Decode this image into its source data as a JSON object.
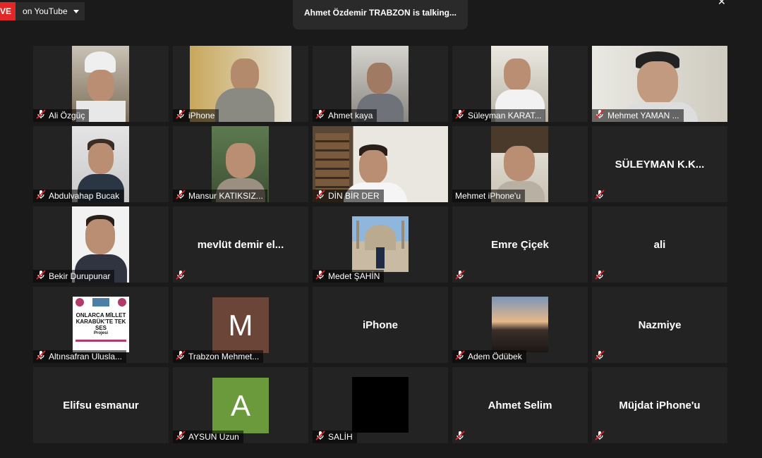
{
  "live": {
    "badge": "VE",
    "platform": "on YouTube"
  },
  "talking": "Ahmet Özdemir TRABZON is talking...",
  "tiles": [
    {
      "name": "Ali Özgüç"
    },
    {
      "name": "iPhone"
    },
    {
      "name": "Ahmet kaya"
    },
    {
      "name": "Süleyman KARAT..."
    },
    {
      "name": "Mehmet YAMAN ..."
    },
    {
      "name": "Abdulvahap Bucak"
    },
    {
      "name": "Mansur KATIKSIZ..."
    },
    {
      "name": "DİN BİR DER"
    },
    {
      "name": "Mehmet iPhone'u"
    },
    {
      "name": "SÜLEYMAN  K.K..."
    },
    {
      "name": "Bekir Durupunar"
    },
    {
      "name": "mevlüt  demir  el..."
    },
    {
      "name": "Medet ŞAHİN"
    },
    {
      "name": "Emre Çiçek"
    },
    {
      "name": "ali"
    },
    {
      "name": "Altınsafran Uluslа...",
      "thumb_lines": [
        "ONLARCA MİLLET",
        "KARABÜK'TE TEK SES",
        "Projesi"
      ]
    },
    {
      "name": "Trabzon Mehmet...",
      "initial": "M"
    },
    {
      "name": "iPhone"
    },
    {
      "name": "Adem Ödübek"
    },
    {
      "name": "Nazmiye"
    },
    {
      "name": "Elifsu esmanur"
    },
    {
      "name": "AYSUN Uzun",
      "initial": "A"
    },
    {
      "name": "SALİH"
    },
    {
      "name": "Ahmet Selim"
    },
    {
      "name": "Müjdat iPhone'u"
    }
  ]
}
